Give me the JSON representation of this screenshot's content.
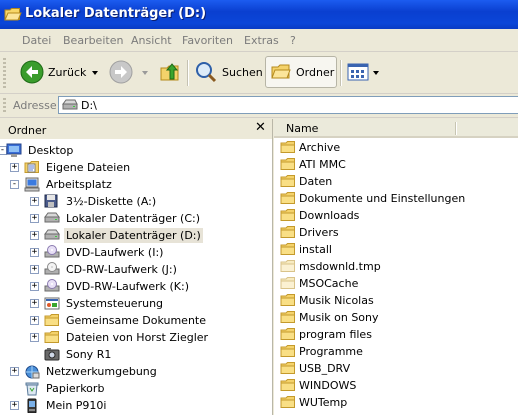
{
  "window": {
    "title": "Lokaler Datenträger (D:)"
  },
  "menu": [
    "Datei",
    "Bearbeiten",
    "Ansicht",
    "Favoriten",
    "Extras",
    "?"
  ],
  "toolbar": {
    "back_label": "Zurück",
    "search_label": "Suchen",
    "folders_label": "Ordner"
  },
  "address": {
    "label": "Adresse",
    "value": "D:\\"
  },
  "left_pane": {
    "title": "Ordner",
    "tree": [
      {
        "label": "Desktop",
        "icon": "desktop-icon"
      },
      {
        "label": "Eigene Dateien",
        "icon": "my-documents-icon"
      },
      {
        "label": "Arbeitsplatz",
        "icon": "my-computer-icon"
      },
      {
        "label": "3½-Diskette (A:)",
        "icon": "floppy-icon"
      },
      {
        "label": "Lokaler Datenträger (C:)",
        "icon": "hard-drive-icon"
      },
      {
        "label": "Lokaler Datenträger (D:)",
        "icon": "hard-drive-icon",
        "selected": true
      },
      {
        "label": "DVD-Laufwerk (I:)",
        "icon": "dvd-drive-icon"
      },
      {
        "label": "CD-RW-Laufwerk (J:)",
        "icon": "cd-drive-icon"
      },
      {
        "label": "DVD-RW-Laufwerk (K:)",
        "icon": "dvd-drive-icon"
      },
      {
        "label": "Systemsteuerung",
        "icon": "control-panel-icon"
      },
      {
        "label": "Gemeinsame Dokumente",
        "icon": "folder-icon"
      },
      {
        "label": "Dateien von Horst Ziegler",
        "icon": "folder-icon"
      },
      {
        "label": "Sony R1",
        "icon": "camera-icon"
      },
      {
        "label": "Netzwerkumgebung",
        "icon": "network-icon"
      },
      {
        "label": "Papierkorb",
        "icon": "recycle-bin-icon"
      },
      {
        "label": "Mein P910i",
        "icon": "phone-icon"
      }
    ]
  },
  "right_pane": {
    "column_name": "Name",
    "files": [
      {
        "name": "Archive",
        "icon": "folder-icon"
      },
      {
        "name": "ATI MMC",
        "icon": "folder-icon"
      },
      {
        "name": "Daten",
        "icon": "folder-icon"
      },
      {
        "name": "Dokumente und Einstellungen",
        "icon": "folder-icon"
      },
      {
        "name": "Downloads",
        "icon": "folder-icon"
      },
      {
        "name": "Drivers",
        "icon": "folder-icon"
      },
      {
        "name": "install",
        "icon": "folder-icon"
      },
      {
        "name": "msdownld.tmp",
        "icon": "folder-hidden-icon"
      },
      {
        "name": "MSOCache",
        "icon": "folder-hidden-icon"
      },
      {
        "name": "Musik Nicolas",
        "icon": "folder-icon"
      },
      {
        "name": "Musik on Sony",
        "icon": "folder-icon"
      },
      {
        "name": "program files",
        "icon": "folder-icon"
      },
      {
        "name": "Programme",
        "icon": "folder-icon"
      },
      {
        "name": "USB_DRV",
        "icon": "folder-icon"
      },
      {
        "name": "WINDOWS",
        "icon": "folder-icon"
      },
      {
        "name": "WUTemp",
        "icon": "folder-icon"
      }
    ]
  },
  "colors": {
    "title_bar": "#0a3fd0",
    "folder": "#f4d26a",
    "selection": "#e7e3d7"
  }
}
